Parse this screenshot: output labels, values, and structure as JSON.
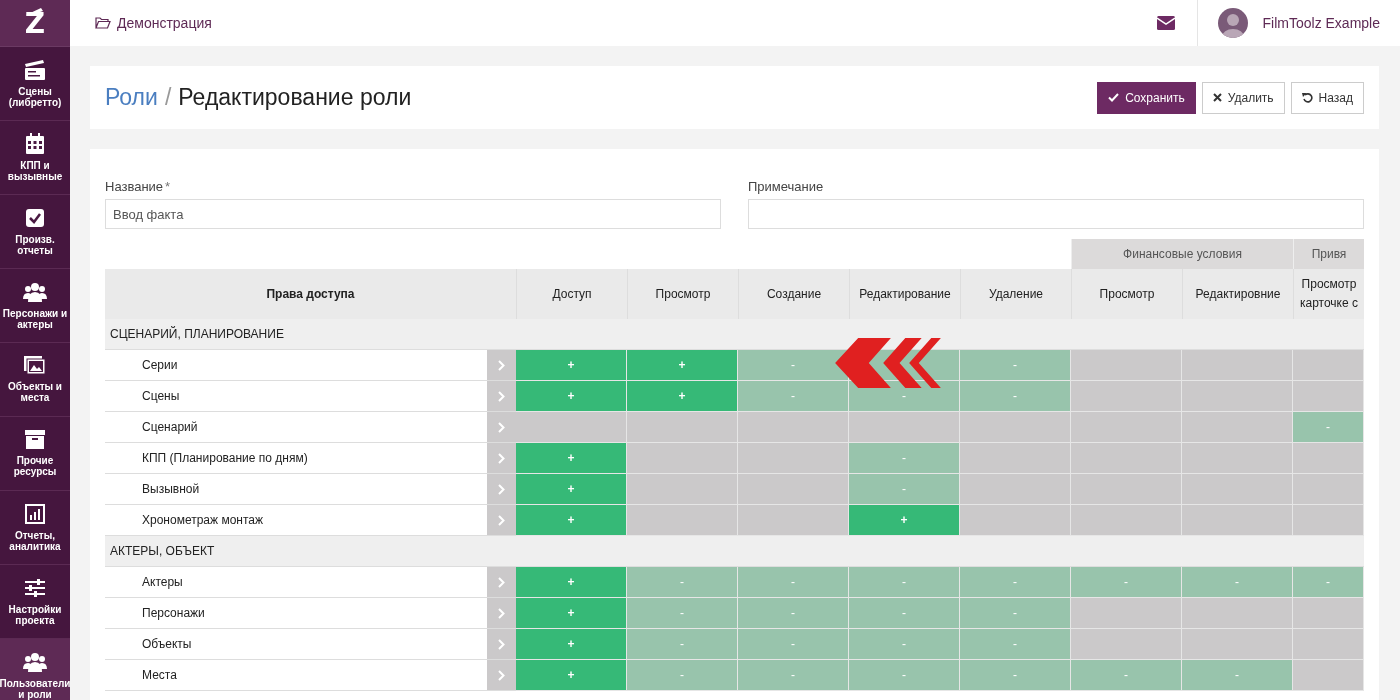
{
  "sidebar": {
    "logo": "Z",
    "items": [
      {
        "label": "Сцены (либретто)",
        "selected": false
      },
      {
        "label": "КПП и вызывные",
        "selected": false
      },
      {
        "label": "Произв. отчеты",
        "selected": false
      },
      {
        "label": "Персонажи и актеры",
        "selected": false
      },
      {
        "label": "Объекты и места",
        "selected": false
      },
      {
        "label": "Прочие ресурсы",
        "selected": false
      },
      {
        "label": "Отчеты, аналитика",
        "selected": false
      },
      {
        "label": "Настройки проекта",
        "selected": false
      },
      {
        "label": "Пользователи и роли",
        "selected": true
      }
    ]
  },
  "header": {
    "project": "Демонстрация",
    "user": "FilmToolz Example"
  },
  "title_bar": {
    "breadcrumb": {
      "link": "Роли",
      "separator": "/",
      "title": "Редактирование роли"
    },
    "buttons": [
      {
        "kind": "save",
        "label": "Сохранить"
      },
      {
        "kind": "delete",
        "label": "Удалить"
      },
      {
        "kind": "back",
        "label": "Назад"
      }
    ]
  },
  "form": {
    "fields": [
      {
        "label": "Название",
        "required_mark": "*",
        "value": "Ввод факта"
      },
      {
        "label": "Примечание"
      }
    ]
  },
  "table": {
    "first_column": "Права доступа",
    "column_sets": [
      {
        "columns": [
          "Доступ",
          "Просмотр",
          "Создание",
          "Редактирование",
          "Удаление"
        ]
      },
      {
        "title": "Финансовые условия",
        "columns": [
          "Просмотр",
          "Редактировние"
        ]
      },
      {
        "title": "Привя",
        "columns": [
          "Просмотр карточке с"
        ]
      }
    ],
    "sections": [
      {
        "title": "СЦЕНАРИЙ, ПЛАНИРОВАНИЕ",
        "rows": [
          {
            "name": "Серии",
            "cells": [
              {
                "kind": "granted",
                "text": "+"
              },
              {
                "kind": "granted",
                "text": "+"
              },
              {
                "kind": "denied",
                "text": "-"
              },
              {
                "kind": "denied"
              },
              {
                "kind": "denied",
                "text": "-"
              },
              {
                "kind": "unavailable"
              },
              {
                "kind": "unavailable"
              },
              {
                "kind": "unavailable"
              }
            ]
          },
          {
            "name": "Сцены",
            "cells": [
              {
                "kind": "granted",
                "text": "+"
              },
              {
                "kind": "granted",
                "text": "+"
              },
              {
                "kind": "denied",
                "text": "-"
              },
              {
                "kind": "denied",
                "text": "-"
              },
              {
                "kind": "denied",
                "text": "-"
              },
              {
                "kind": "unavailable"
              },
              {
                "kind": "unavailable"
              },
              {
                "kind": "unavailable"
              }
            ]
          },
          {
            "name": "Сценарий",
            "cells": [
              {
                "kind": "unavailable"
              },
              {
                "kind": "unavailable"
              },
              {
                "kind": "unavailable"
              },
              {
                "kind": "unavailable"
              },
              {
                "kind": "unavailable"
              },
              {
                "kind": "unavailable"
              },
              {
                "kind": "unavailable"
              },
              {
                "kind": "denied",
                "text": "-"
              }
            ]
          },
          {
            "name": "КПП (Планирование по дням)",
            "cells": [
              {
                "kind": "granted",
                "text": "+"
              },
              {
                "kind": "unavailable"
              },
              {
                "kind": "unavailable"
              },
              {
                "kind": "denied",
                "text": "-"
              },
              {
                "kind": "unavailable"
              },
              {
                "kind": "unavailable"
              },
              {
                "kind": "unavailable"
              },
              {
                "kind": "unavailable"
              }
            ]
          },
          {
            "name": "Вызывной",
            "cells": [
              {
                "kind": "granted",
                "text": "+"
              },
              {
                "kind": "unavailable"
              },
              {
                "kind": "unavailable"
              },
              {
                "kind": "denied",
                "text": "-"
              },
              {
                "kind": "unavailable"
              },
              {
                "kind": "unavailable"
              },
              {
                "kind": "unavailable"
              },
              {
                "kind": "unavailable"
              }
            ]
          },
          {
            "name": "Хронометраж монтаж",
            "cells": [
              {
                "kind": "granted",
                "text": "+"
              },
              {
                "kind": "unavailable"
              },
              {
                "kind": "unavailable"
              },
              {
                "kind": "granted",
                "text": "+"
              },
              {
                "kind": "unavailable"
              },
              {
                "kind": "unavailable"
              },
              {
                "kind": "unavailable"
              },
              {
                "kind": "unavailable"
              }
            ]
          }
        ]
      },
      {
        "title": "АКТЕРЫ, ОБЪЕКТ",
        "rows": [
          {
            "name": "Актеры",
            "cells": [
              {
                "kind": "granted",
                "text": "+"
              },
              {
                "kind": "denied",
                "text": "-"
              },
              {
                "kind": "denied",
                "text": "-"
              },
              {
                "kind": "denied",
                "text": "-"
              },
              {
                "kind": "denied",
                "text": "-"
              },
              {
                "kind": "denied",
                "text": "-"
              },
              {
                "kind": "denied",
                "text": "-"
              },
              {
                "kind": "denied",
                "text": "-"
              }
            ]
          },
          {
            "name": "Персонажи",
            "cells": [
              {
                "kind": "granted",
                "text": "+"
              },
              {
                "kind": "denied",
                "text": "-"
              },
              {
                "kind": "denied",
                "text": "-"
              },
              {
                "kind": "denied",
                "text": "-"
              },
              {
                "kind": "denied",
                "text": "-"
              },
              {
                "kind": "unavailable"
              },
              {
                "kind": "unavailable"
              },
              {
                "kind": "unavailable"
              }
            ]
          },
          {
            "name": "Объекты",
            "cells": [
              {
                "kind": "granted",
                "text": "+"
              },
              {
                "kind": "denied",
                "text": "-"
              },
              {
                "kind": "denied",
                "text": "-"
              },
              {
                "kind": "denied",
                "text": "-"
              },
              {
                "kind": "denied",
                "text": "-"
              },
              {
                "kind": "unavailable"
              },
              {
                "kind": "unavailable"
              },
              {
                "kind": "unavailable"
              }
            ]
          },
          {
            "name": "Места",
            "cells": [
              {
                "kind": "granted",
                "text": "+"
              },
              {
                "kind": "denied",
                "text": "-"
              },
              {
                "kind": "denied",
                "text": "-"
              },
              {
                "kind": "denied",
                "text": "-"
              },
              {
                "kind": "denied",
                "text": "-"
              },
              {
                "kind": "denied",
                "text": "-"
              },
              {
                "kind": "denied",
                "text": "-"
              },
              {
                "kind": "unavailable"
              }
            ]
          }
        ]
      }
    ]
  }
}
